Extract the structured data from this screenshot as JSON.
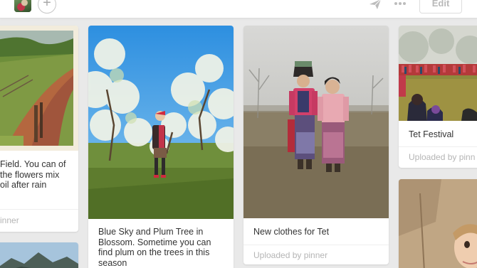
{
  "header": {
    "add_label": "+",
    "edit_label": "Edit",
    "icons": [
      "avatar",
      "add-icon",
      "send-icon",
      "more-icon"
    ]
  },
  "pins": [
    {
      "description": "Field. You can of the flowers mix oil after rain",
      "source": "inner"
    },
    {
      "description": "Blue Sky and Plum Tree in Blossom. Sometime you can find plum on the trees in this season"
    },
    {
      "description": "New clothes for Tet",
      "source": "Uploaded by pinner"
    },
    {
      "description": "Tet Festival",
      "source": "Uploaded by pinn"
    }
  ]
}
